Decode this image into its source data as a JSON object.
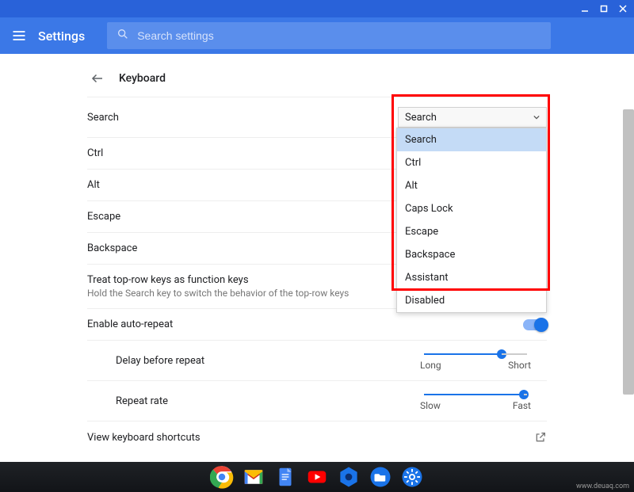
{
  "window": {
    "minimize": "minimize",
    "maximize": "maximize",
    "close": "close"
  },
  "header": {
    "title": "Settings",
    "search_placeholder": "Search settings"
  },
  "page": {
    "title": "Keyboard",
    "rows": {
      "search": {
        "label": "Search",
        "dropdown_value": "Search"
      },
      "ctrl": {
        "label": "Ctrl"
      },
      "alt": {
        "label": "Alt"
      },
      "escape": {
        "label": "Escape"
      },
      "backspace": {
        "label": "Backspace"
      },
      "fnkeys": {
        "label": "Treat top-row keys as function keys",
        "sub": "Hold the Search key to switch the behavior of the top-row keys"
      },
      "autorepeat": {
        "label": "Enable auto-repeat"
      },
      "delay": {
        "label": "Delay before repeat",
        "left": "Long",
        "right": "Short"
      },
      "rate": {
        "label": "Repeat rate",
        "left": "Slow",
        "right": "Fast"
      },
      "shortcuts": {
        "label": "View keyboard shortcuts"
      }
    },
    "dropdown_options": [
      "Search",
      "Ctrl",
      "Alt",
      "Caps Lock",
      "Escape",
      "Backspace",
      "Assistant",
      "Disabled"
    ]
  },
  "watermark": "www.deuaq.com"
}
